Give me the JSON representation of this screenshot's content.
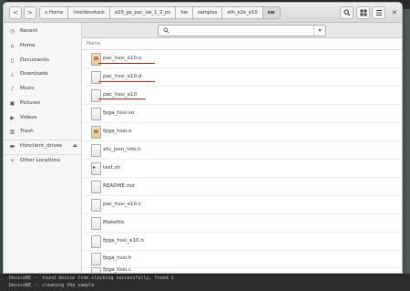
{
  "window": {
    "nav": {
      "back": "<",
      "forward": ">"
    },
    "breadcrumbs": [
      "Home",
      "inteldevstack",
      "a10_gx_pac_ias_1_2_pv",
      "hw",
      "samples",
      "eth_e2e_e10",
      "sw"
    ],
    "toolbar": {
      "search_icon": "search-icon",
      "view_icon": "grid-icon",
      "menu_icon": "menu-icon",
      "close": "✕"
    },
    "search_bar": {
      "dropdown": "▾"
    }
  },
  "sidebar": {
    "items": [
      {
        "label": "Recent",
        "icon": "clock-icon"
      },
      {
        "label": "Home",
        "icon": "home-icon"
      },
      {
        "label": "Documents",
        "icon": "documents-icon"
      },
      {
        "label": "Downloads",
        "icon": "downloads-icon"
      },
      {
        "label": "Music",
        "icon": "music-icon"
      },
      {
        "label": "Pictures",
        "icon": "pictures-icon"
      },
      {
        "label": "Videos",
        "icon": "videos-icon"
      },
      {
        "label": "Trash",
        "icon": "trash-icon"
      },
      {
        "label": "thinclient_drives",
        "icon": "drive-icon"
      },
      {
        "label": "Other Locations",
        "icon": "plus-icon"
      }
    ]
  },
  "files": {
    "header": "Name",
    "rows": [
      {
        "name": "pac_hssi_e10.o",
        "type": "code"
      },
      {
        "name": "pac_hssi_e10.d",
        "type": "text"
      },
      {
        "name": "pac_hssi_e10",
        "type": "text"
      },
      {
        "name": "fpga_hssi.so",
        "type": "text"
      },
      {
        "name": "fpga_hssi.o",
        "type": "code"
      },
      {
        "name": "afu_json_info.h",
        "type": "text"
      },
      {
        "name": "test.sh",
        "type": "sh"
      },
      {
        "name": "README.md",
        "type": "text"
      },
      {
        "name": "pac_hssi_e10.c",
        "type": "text"
      },
      {
        "name": "Makefile",
        "type": "text"
      },
      {
        "name": "fpga_hssi_e10.h",
        "type": "text"
      },
      {
        "name": "fpga_hssi.h",
        "type": "text"
      },
      {
        "name": "fpga_hssi.c",
        "type": "text"
      }
    ]
  },
  "terminal": {
    "line1": "DeviceNE -- found device from clocking successfully, found 1",
    "line2": "DeviceNE -- cleaning the sample"
  },
  "colors": {
    "underline": "#d01a1a"
  }
}
